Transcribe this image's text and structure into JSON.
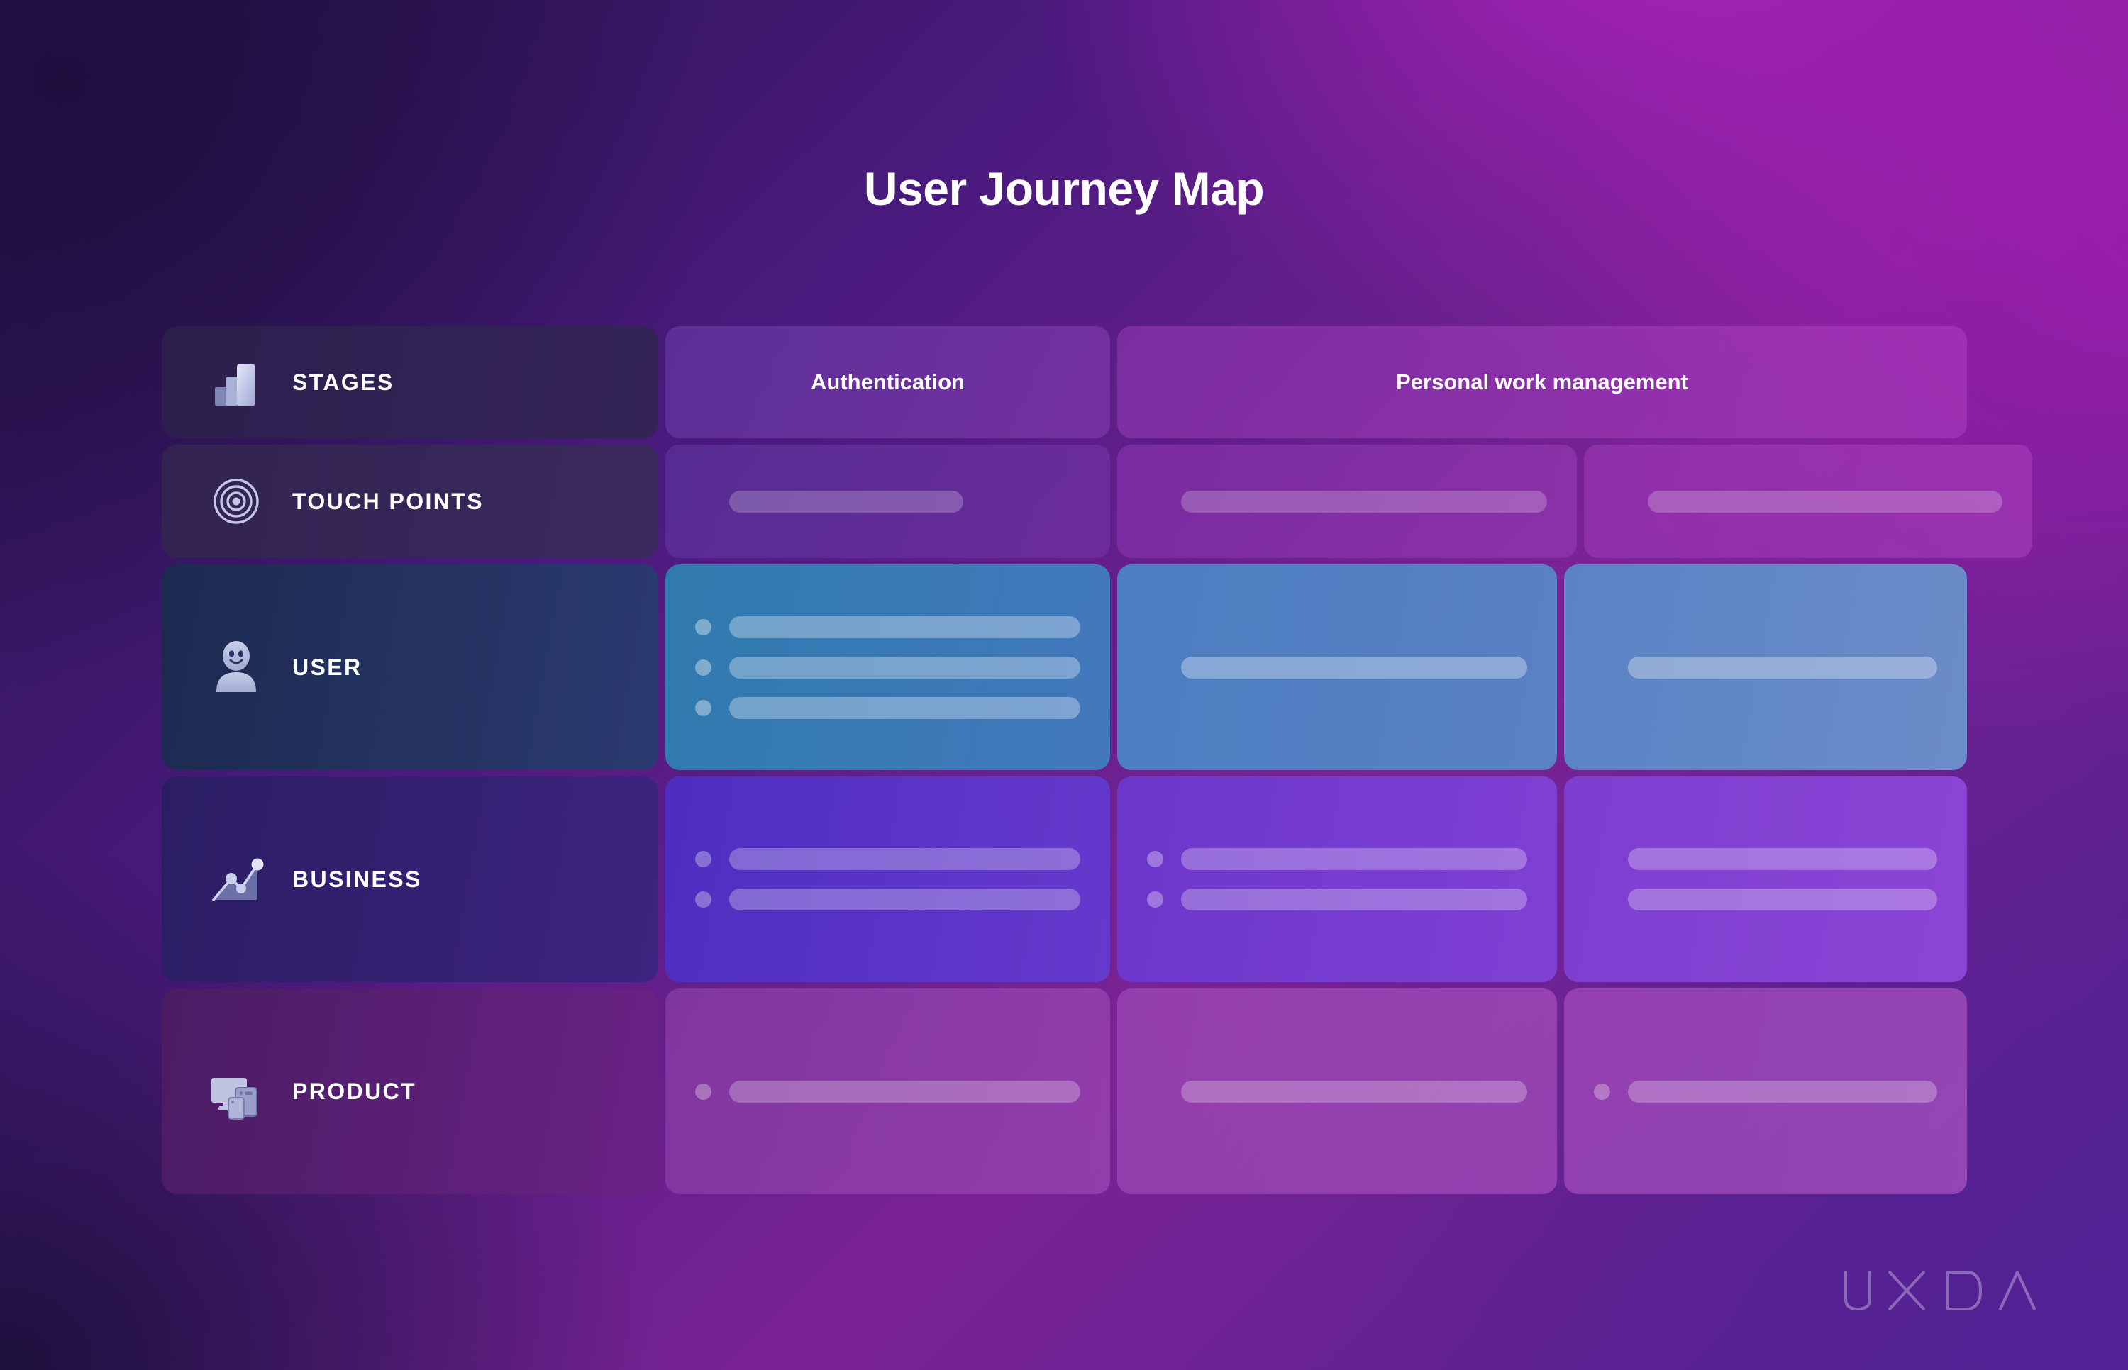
{
  "title": "User Journey Map",
  "brand": {
    "logo_text": "UXDA",
    "logo_color": "#b9a2d8"
  },
  "theme": {
    "background_top_left": "#241347",
    "background_top_right": "#931fa8",
    "background_bottom_left": "#1f1340",
    "background_bottom_right": "#4c1f8c",
    "title_color": "#ffffff",
    "user_row_accent": "#3f79bd",
    "business_row_accent": "#6639cd",
    "product_row_accent": "#9a46b2"
  },
  "columns": [
    {
      "id": "authentication",
      "label": "Authentication",
      "span": 1
    },
    {
      "id": "personal-work-management",
      "label": "Personal work management",
      "span": 2
    }
  ],
  "rows": [
    {
      "id": "stages",
      "label": "STAGES",
      "icon": "bar-chart-icon",
      "type": "header"
    },
    {
      "id": "touch-points",
      "label": "TOUCH POINTS",
      "icon": "target-icon",
      "type": "content",
      "cells": [
        {
          "items": [
            {
              "bullet": false,
              "bar_width": "touch"
            }
          ]
        },
        {
          "items": [
            {
              "bullet": false,
              "bar_width": "touch2"
            }
          ]
        },
        {
          "items": [
            {
              "bullet": false,
              "bar_width": "touch3"
            }
          ]
        }
      ]
    },
    {
      "id": "user",
      "label": "USER",
      "icon": "person-smile-icon",
      "type": "content",
      "cells": [
        {
          "items": [
            {
              "bullet": true,
              "bar_width": "full"
            },
            {
              "bullet": true,
              "bar_width": "full"
            },
            {
              "bullet": true,
              "bar_width": "full"
            }
          ]
        },
        {
          "items": [
            {
              "bullet": false,
              "bar_width": "full"
            }
          ]
        },
        {
          "items": [
            {
              "bullet": false,
              "bar_width": "full"
            }
          ]
        }
      ]
    },
    {
      "id": "business",
      "label": "BUSINESS",
      "icon": "line-chart-icon",
      "type": "content",
      "cells": [
        {
          "items": [
            {
              "bullet": true,
              "bar_width": "full"
            },
            {
              "bullet": true,
              "bar_width": "full"
            }
          ]
        },
        {
          "items": [
            {
              "bullet": true,
              "bar_width": "full"
            },
            {
              "bullet": true,
              "bar_width": "full"
            }
          ]
        },
        {
          "items": [
            {
              "bullet": false,
              "bar_width": "full"
            },
            {
              "bullet": false,
              "bar_width": "full"
            }
          ]
        }
      ]
    },
    {
      "id": "product",
      "label": "PRODUCT",
      "icon": "devices-icon",
      "type": "content",
      "cells": [
        {
          "items": [
            {
              "bullet": true,
              "bar_width": "full"
            }
          ]
        },
        {
          "items": [
            {
              "bullet": false,
              "bar_width": "full"
            }
          ]
        },
        {
          "items": [
            {
              "bullet": true,
              "bar_width": "full"
            }
          ]
        }
      ]
    }
  ]
}
